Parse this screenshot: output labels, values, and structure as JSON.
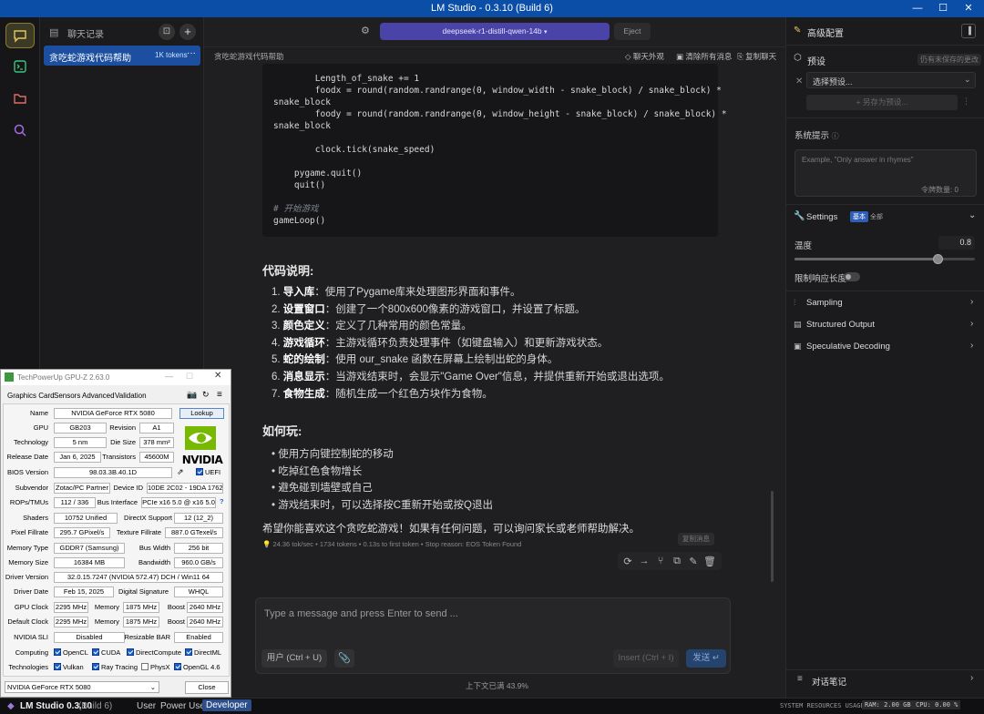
{
  "window": {
    "title": "LM Studio - 0.3.10 (Build 6)"
  },
  "chats": {
    "header": "聊天记录",
    "items": [
      {
        "title": "贪吃蛇游戏代码帮助",
        "tokens": "1K tokens"
      }
    ]
  },
  "topbar": {
    "model": "deepseek-r1-distill-qwen-14b",
    "eject": "Eject"
  },
  "subbar": {
    "title": "贪吃蛇游戏代码帮助",
    "appearance": "聊天外观",
    "clear_all": "清除所有消息",
    "copy_chat": "复制聊天"
  },
  "code_lines": [
    "        Length_of_snake += 1",
    "        foodx = round(random.randrange(0, window_width - snake_block) / snake_block) *",
    "snake_block",
    "        foody = round(random.randrange(0, window_height - snake_block) / snake_block) *",
    "snake_block",
    "",
    "        clock.tick(snake_speed)",
    "",
    "    pygame.quit()",
    "    quit()",
    "",
    "# 开始游戏",
    "gameLoop()"
  ],
  "explain": {
    "heading": "代码说明:",
    "items": [
      {
        "n": "1.",
        "b": "导入库",
        "t": "：使用了Pygame库来处理图形界面和事件。"
      },
      {
        "n": "2.",
        "b": "设置窗口",
        "t": "：创建了一个800x600像素的游戏窗口，并设置了标题。"
      },
      {
        "n": "3.",
        "b": "颜色定义",
        "t": "：定义了几种常用的颜色常量。"
      },
      {
        "n": "4.",
        "b": "游戏循环",
        "t": "：主游戏循环负责处理事件（如键盘输入）和更新游戏状态。"
      },
      {
        "n": "5.",
        "b": "蛇的绘制",
        "t": "：使用 our_snake 函数在屏幕上绘制出蛇的身体。"
      },
      {
        "n": "6.",
        "b": "消息显示",
        "t": "：当游戏结束时，会显示\"Game Over\"信息，并提供重新开始或退出选项。"
      },
      {
        "n": "7.",
        "b": "食物生成",
        "t": "：随机生成一个红色方块作为食物。"
      }
    ]
  },
  "howto": {
    "heading": "如何玩:",
    "items": [
      "使用方向键控制蛇的移动",
      "吃掉红色食物增长",
      "避免碰到墙壁或自己",
      "游戏结束时，可以选择按C重新开始或按Q退出"
    ]
  },
  "closing": "希望你能喜欢这个贪吃蛇游戏！如果有任何问题，可以询问家长或老师帮助解决。",
  "stats": "24.36 tok/sec • 1734 tokens • 0.13s to first token • Stop reason: EOS Token Found",
  "regen_label": "复制消息",
  "composer": {
    "placeholder": "Type a message and press Enter to send ...",
    "user_btn": "用户 (Ctrl + U)",
    "insert_btn": "Insert (Ctrl + I)",
    "send_btn": "发送"
  },
  "context_usage": "上下文已满 43.9%",
  "right": {
    "title": "高级配置",
    "preset_label": "预设",
    "preset_note": "仍有未保存的更改",
    "preset_select": "选择预设...",
    "save_as": "+ 另存为预设...",
    "system_prompt": "系统提示",
    "system_placeholder": "Example, \"Only answer in rhymes\"",
    "token_count": "令牌数量: 0",
    "settings": "Settings",
    "settings_badge1": "基本",
    "settings_badge2": "全部",
    "temperature": "温度",
    "temperature_value": "0.8",
    "temperature_fraction": 0.8,
    "limit_length": "限制响应长度",
    "sampling": "Sampling",
    "structured": "Structured Output",
    "speculative": "Speculative Decoding",
    "dialog": "对话笔记"
  },
  "status": {
    "app": "LM Studio 0.3.10",
    "build": "(Build 6)",
    "mode_user": "User",
    "mode_power": "Power User",
    "mode_dev": "Developer",
    "sys_label": "SYSTEM RESOURCES USAGE:",
    "ram": "RAM: 2.00 GB",
    "cpu": "CPU: 0.00 %"
  },
  "gpuz": {
    "title": "TechPowerUp GPU-Z 2.63.0",
    "tabs": [
      "Graphics Card",
      "Sensors",
      "Advanced",
      "Validation"
    ],
    "name_label": "Name",
    "name": "NVIDIA GeForce RTX 5080",
    "lookup": "Lookup",
    "gpu_label": "GPU",
    "gpu": "GB203",
    "revision_label": "Revision",
    "revision": "A1",
    "tech_label": "Technology",
    "tech": "5 nm",
    "die_label": "Die Size",
    "die": "378 mm²",
    "release_label": "Release Date",
    "release": "Jan 6, 2025",
    "transistors_label": "Transistors",
    "transistors": "45600M",
    "bios_label": "BIOS Version",
    "bios": "98.03.3B.40.1D",
    "uefi": "UEFI",
    "subvendor_label": "Subvendor",
    "subvendor": "Zotac/PC Partner",
    "device_label": "Device ID",
    "device": "10DE 2C02 - 19DA 1762",
    "rops_label": "ROPs/TMUs",
    "rops": "112 / 336",
    "bus_label": "Bus Interface",
    "bus": "PCIe x16 5.0 @ x16 5.0",
    "shaders_label": "Shaders",
    "shaders": "10752 Unified",
    "dx_label": "DirectX Support",
    "dx": "12 (12_2)",
    "pixel_label": "Pixel Fillrate",
    "pixel": "295.7 GPixel/s",
    "texture_label": "Texture Fillrate",
    "texture": "887.0 GTexel/s",
    "memtype_label": "Memory Type",
    "memtype": "GDDR7 (Samsung)",
    "buswidth_label": "Bus Width",
    "buswidth": "256 bit",
    "memsize_label": "Memory Size",
    "memsize": "16384 MB",
    "bandwidth_label": "Bandwidth",
    "bandwidth": "960.0 GB/s",
    "driver_label": "Driver Version",
    "driver": "32.0.15.7247 (NVIDIA 572.47) DCH / Win11 64",
    "driverdate_label": "Driver Date",
    "driverdate": "Feb 15, 2025",
    "sig_label": "Digital Signature",
    "sig": "WHQL",
    "gpuclock_label": "GPU Clock",
    "gpuclock": "2295 MHz",
    "mem_label": "Memory",
    "memclock": "1875 MHz",
    "boost_label": "Boost",
    "boost": "2640 MHz",
    "defclock_label": "Default Clock",
    "defclock": "2295 MHz",
    "defmem": "1875 MHz",
    "defboost": "2640 MHz",
    "sli_label": "NVIDIA SLI",
    "sli": "Disabled",
    "rebar_label": "Resizable BAR",
    "rebar": "Enabled",
    "computing_label": "Computing",
    "computing": [
      "OpenCL",
      "CUDA",
      "DirectCompute",
      "DirectML"
    ],
    "tech2_label": "Technologies",
    "technologies": [
      "Vulkan",
      "Ray Tracing",
      "PhysX",
      "OpenGL 4.6"
    ],
    "selector": "NVIDIA GeForce RTX 5080",
    "close": "Close",
    "logo": "NVIDIA"
  }
}
